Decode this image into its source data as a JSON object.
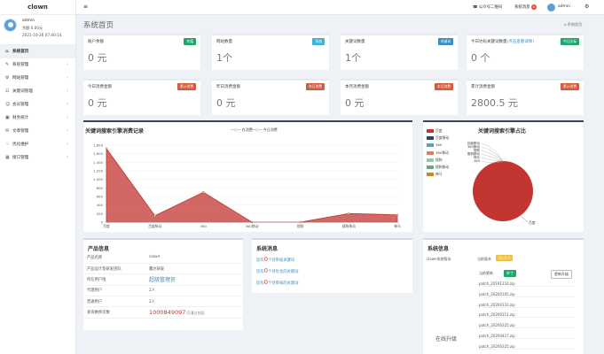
{
  "app": {
    "brand": "clown"
  },
  "user": {
    "name": "admin",
    "balance": "余额 0.00元",
    "time": "2021-10-26 07:40:14"
  },
  "menu": [
    {
      "icon": "⌂",
      "label": "系统首页",
      "active": true,
      "arrow": ""
    },
    {
      "icon": "✎",
      "label": "系统管理",
      "arrow": "‹"
    },
    {
      "icon": "⚙",
      "label": "网站管理",
      "arrow": "‹"
    },
    {
      "icon": "☷",
      "label": "关键词管理",
      "arrow": "‹"
    },
    {
      "icon": "☺",
      "label": "会员管理",
      "arrow": "‹"
    },
    {
      "icon": "▣",
      "label": "财务统计",
      "arrow": "‹"
    },
    {
      "icon": "✉",
      "label": "文章管理",
      "arrow": "‹"
    },
    {
      "icon": "♢",
      "label": "优化维护",
      "arrow": "‹"
    },
    {
      "icon": "▦",
      "label": "接口管理",
      "arrow": "‹"
    }
  ],
  "topbar": {
    "menu_icon": "≡",
    "qr": "公众号二维码",
    "msg": "系统消息",
    "msg_count": "0",
    "user": "admin",
    "settings_icon": "⚙"
  },
  "page": {
    "title": "系统首页",
    "breadcrumb": "系统首页"
  },
  "cards_row1": [
    {
      "title": "账户余额",
      "tag": "充值",
      "tag_color": "#1fa66a",
      "value": "0 元"
    },
    {
      "title": "网站数量",
      "tag": "添加",
      "tag_color": "#3bb3d4",
      "value": "1个"
    },
    {
      "title": "关键词数量",
      "tag": "关键词",
      "tag_color": "#3c8dbc",
      "value": "1个"
    },
    {
      "title": "今日达标关键词数量",
      "tag": "今日达标",
      "tag_color": "#1fa66a",
      "value": "0 个",
      "subtitle": "(点击查看详情)"
    }
  ],
  "cards_row2": [
    {
      "title": "今日消费金额",
      "tag": "累计消费",
      "tag_color": "#d35a3a",
      "value": "0 元"
    },
    {
      "title": "昨日消费金额",
      "tag": "昨日消费",
      "tag_color": "#d35a3a",
      "value": "0 元"
    },
    {
      "title": "本月消费金额",
      "tag": "本月消费",
      "tag_color": "#d35a3a",
      "value": "0 元"
    },
    {
      "title": "累计消费金额",
      "tag": "累计消费",
      "tag_color": "#d35a3a",
      "value": "2800.5 元"
    }
  ],
  "chart_data": [
    {
      "type": "area",
      "title": "关键词搜索引擎消费记录",
      "legend": [
        "在消费",
        "今日消费"
      ],
      "categories": [
        "百度",
        "百度移动",
        "360",
        "360移动",
        "搜狗",
        "搜狗移动",
        "神马"
      ],
      "yticks": [
        "1,800",
        "1,600",
        "1,400",
        "1,200",
        "1,000",
        "800",
        "600",
        "400",
        "200",
        "0"
      ],
      "ylim": [
        0,
        1800
      ],
      "series": [
        {
          "name": "在消费",
          "values": [
            1720,
            150,
            700,
            0,
            0,
            200,
            170
          ]
        }
      ],
      "color": "#c23531"
    },
    {
      "type": "pie",
      "title": "关键词搜索引擎占比",
      "legend": [
        "百度",
        "百度移动",
        "360",
        "360移动",
        "搜狗",
        "搜狗移动",
        "神马"
      ],
      "colors": [
        "#c23531",
        "#2f4554",
        "#61a0a8",
        "#d48265",
        "#91c7ae",
        "#749f83",
        "#ca8622"
      ],
      "values": [
        100,
        0,
        0,
        0,
        0,
        0,
        0
      ],
      "labels_outside": [
        "百度移动",
        "360移动",
        "搜狗",
        "搜狗移动",
        "神马",
        "360"
      ],
      "center_label": "百度"
    }
  ],
  "product_info": {
    "title": "产品信息",
    "rows": [
      {
        "k": "产品名称",
        "v": "clown"
      },
      {
        "k": "产品设计及研发团队",
        "v": "鑫达研发"
      },
      {
        "k": "所在用户组",
        "v": "超级管理员",
        "style": "link"
      },
      {
        "k": "代理用户",
        "v": "2人"
      },
      {
        "k": "普通用户",
        "v": "2人"
      },
      {
        "k": "查询剩余次数",
        "v": "1000849097",
        "suffix": "(可通过充值)",
        "style": "num"
      }
    ]
  },
  "system_msg": {
    "title": "系统消息",
    "items": [
      {
        "pre": "您有",
        "num": "0",
        "text": "个待审核关键词"
      },
      {
        "pre": "您有",
        "num": "0",
        "text": "个待优化的关键词"
      },
      {
        "pre": "您有",
        "num": "0",
        "text": "个待审核的关键词"
      }
    ]
  },
  "sys_info": {
    "title": "系统信息",
    "version_label": "clown系统版本",
    "version_tag": "当前版本 ",
    "version_value": "V1.0.0",
    "current_label": "当前更新",
    "current_tag": "补丁",
    "reset": "更新升级",
    "online_upgrade": "在线升级",
    "patches": [
      "patch_20191216.zip",
      "patch_20200105.zip",
      "patch_20200110.zip",
      "patch_20200311.zip",
      "patch_20200325.zip",
      "patch_20200417.zip",
      "patch_20200325.zip"
    ]
  }
}
